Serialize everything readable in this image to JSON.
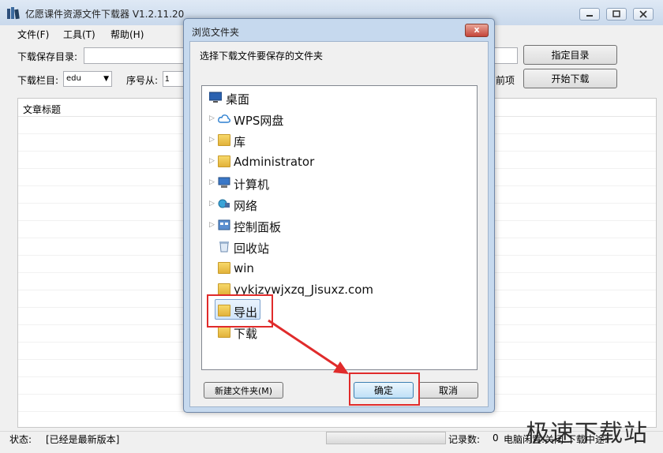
{
  "window": {
    "title": "亿愿课件资源文件下载器 V1.2.11.20",
    "menu": [
      "文件(F)",
      "工具(T)",
      "帮助(H)"
    ]
  },
  "form": {
    "save_dir_label": "下载保存目录:",
    "save_dir_value": "",
    "category_label": "下载栏目:",
    "category_value": "edu",
    "seq_label": "序号从:",
    "seq_value": "1",
    "prev_items_label": "前项",
    "choose_dir_button": "指定目录",
    "start_download_button": "开始下载"
  },
  "list": {
    "column_title": "文章标题"
  },
  "status": {
    "label": "状态:",
    "value": "[已经是最新版本]",
    "records_label": "记录数:",
    "records_value": "0",
    "extra_text": "电脑闲置:关闭 下载中途:"
  },
  "dialog": {
    "title": "浏览文件夹",
    "close_label": "x",
    "description": "选择下载文件要保存的文件夹",
    "tree": [
      {
        "label": "桌面",
        "icon": "desktop-icon",
        "expandable": false
      },
      {
        "label": "WPS网盘",
        "icon": "cloud-icon",
        "expandable": true
      },
      {
        "label": "库",
        "icon": "library-icon",
        "expandable": true
      },
      {
        "label": "Administrator",
        "icon": "user-folder-icon",
        "expandable": true
      },
      {
        "label": "计算机",
        "icon": "computer-icon",
        "expandable": true
      },
      {
        "label": "网络",
        "icon": "network-icon",
        "expandable": true
      },
      {
        "label": "控制面板",
        "icon": "control-panel-icon",
        "expandable": true
      },
      {
        "label": "回收站",
        "icon": "recycle-bin-icon",
        "expandable": false
      },
      {
        "label": "win",
        "icon": "folder-icon",
        "expandable": false
      },
      {
        "label": "yykjzywjxzq_Jisuxz.com",
        "icon": "folder-icon",
        "expandable": false
      },
      {
        "label": "导出",
        "icon": "folder-icon",
        "expandable": false,
        "selected": true
      },
      {
        "label": "下载",
        "icon": "folder-icon",
        "expandable": false
      }
    ],
    "new_folder_button": "新建文件夹(M)",
    "ok_button": "确定",
    "cancel_button": "取消"
  },
  "watermark": "极速下载站",
  "colors": {
    "highlight_red": "#e02b2b",
    "selection_blue": "#d2e5fb"
  }
}
